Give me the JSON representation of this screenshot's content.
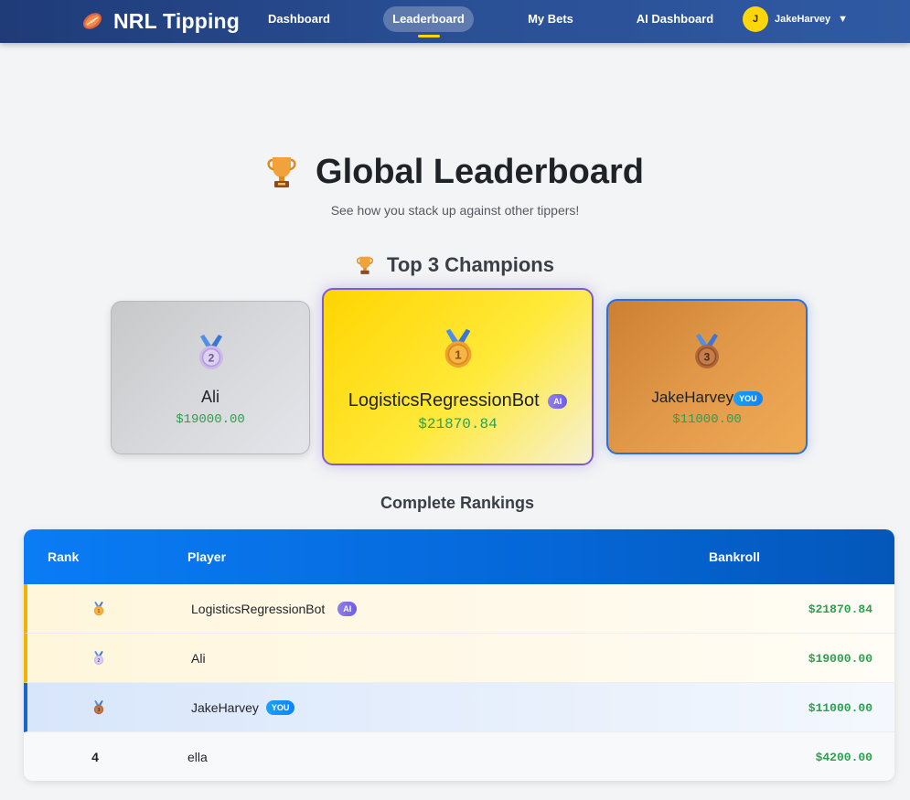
{
  "nav": {
    "brand": "NRL Tipping",
    "links": [
      {
        "label": "Dashboard",
        "active": false
      },
      {
        "label": "Leaderboard",
        "active": true
      },
      {
        "label": "My Bets",
        "active": false
      },
      {
        "label": "AI Dashboard",
        "active": false
      }
    ],
    "user": {
      "initial": "J",
      "name": "JakeHarvey",
      "caret": "▼"
    }
  },
  "header": {
    "title": "Global Leaderboard",
    "subtitle": "See how you stack up against other tippers!"
  },
  "podium": {
    "heading": "Top 3 Champions",
    "first": {
      "rank": "1",
      "name": "LogisticsRegressionBot",
      "badge": "AI",
      "amount": "$21870.84"
    },
    "second": {
      "rank": "2",
      "name": "Ali",
      "amount": "$19000.00"
    },
    "third": {
      "rank": "3",
      "name": "JakeHarvey",
      "badge": "YOU",
      "amount": "$11000.00"
    }
  },
  "rankings": {
    "heading": "Complete Rankings",
    "columns": {
      "rank": "Rank",
      "player": "Player",
      "bankroll": "Bankroll"
    },
    "rows": [
      {
        "rank": "1",
        "player": "LogisticsRegressionBot",
        "badge": "AI",
        "bankroll": "$21870.84"
      },
      {
        "rank": "2",
        "player": "Ali",
        "bankroll": "$19000.00"
      },
      {
        "rank": "3",
        "player": "JakeHarvey",
        "badge": "YOU",
        "bankroll": "$11000.00"
      },
      {
        "rank": "4",
        "player": "ella",
        "bankroll": "$4200.00"
      }
    ]
  },
  "colors": {
    "nav_bg": "#1f3b78",
    "accent_yellow": "#ffd60a",
    "gold": "#ffd500",
    "silver": "#d7d8db",
    "bronze": "#cd7f32",
    "money_green": "#2e9e4f",
    "table_header": "#0a7cf5",
    "ai_badge": "#7b6ae6",
    "you_badge": "#0a84ff"
  },
  "icons": {
    "brand": "football-icon",
    "trophy": "trophy-icon",
    "medals": [
      "gold-medal-icon",
      "silver-medal-icon",
      "bronze-medal-icon"
    ]
  }
}
